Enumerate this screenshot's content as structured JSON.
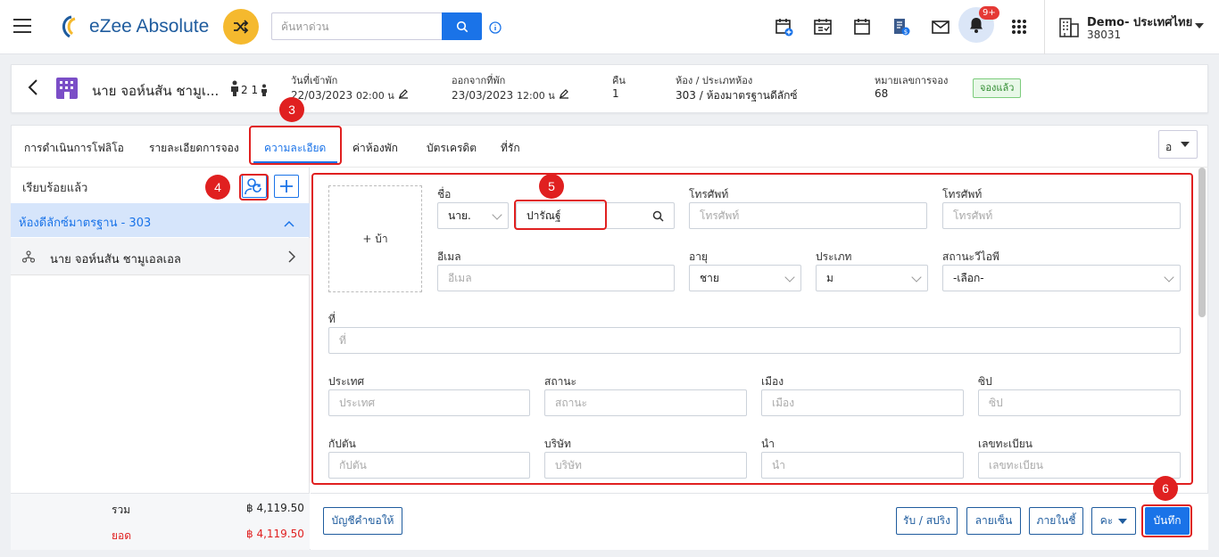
{
  "header": {
    "logo_text": "eZee Absolute",
    "search_placeholder": "ค้นหาด่วน",
    "notification_badge": "9+",
    "hotel_name": "Demo- ประเทศไทย",
    "hotel_id": "38031"
  },
  "booking": {
    "guest_name": "นาย จอห์นสัน ชามูเ...",
    "pax": "2 1",
    "checkin_label": "วันที่เข้าพัก",
    "checkin_date": "22/03/2023",
    "checkin_time": "02:00 น",
    "checkout_label": "ออกจากที่พัก",
    "checkout_date": "23/03/2023",
    "checkout_time": "12:00 น",
    "nights_label": "คืน",
    "nights": "1",
    "room_label": "ห้อง / ประเภทห้อง",
    "room_value": "303 / ห้องมาตรฐานดีลักซ์",
    "resno_label": "หมายเลขการจอง",
    "resno": "68",
    "status": "จองแล้ว"
  },
  "tabs": [
    {
      "label": "การดำเนินการโฟลิโอ"
    },
    {
      "label": "รายละเอียดการจอง"
    },
    {
      "label": "ความละเอียด"
    },
    {
      "label": "ค่าห้องพัก"
    },
    {
      "label": "บัตรเครดิต"
    },
    {
      "label": "ที่รัก"
    }
  ],
  "small_select": "อ",
  "left_panel": {
    "heading": "เรียบร้อยแล้ว",
    "room_group": "ห้องดีลักซ์มาตรฐาน - 303",
    "guest": "นาย จอห์นสัน ชามูเอลเอล",
    "total_label": "รวม",
    "total_value": "฿ 4,119.50",
    "balance_label": "ยอด",
    "balance_value": "฿ 4,119.50"
  },
  "form": {
    "photo_label": "+ บ้า",
    "name_label": "ชื่อ",
    "title_value": "นาย.",
    "name_value": "ปารัณฐ์",
    "phone1_label": "โทรศัพท์",
    "phone1_placeholder": "โทรศัพท์",
    "phone2_label": "โทรศัพท์",
    "phone2_placeholder": "โทรศัพท์",
    "email_label": "อีเมล",
    "email_placeholder": "อีเมล",
    "age_label": "อายุ",
    "age_value": "ชาย",
    "type_label": "ประเภท",
    "type_value": "ม",
    "wifi_label": "สถานะวีไอพี",
    "wifi_value": "-เลือก-",
    "address_label": "ที่",
    "address_placeholder": "ที่",
    "country_label": "ประเทศ",
    "country_placeholder": "ประเทศ",
    "state_label": "สถานะ",
    "state_placeholder": "สถานะ",
    "city_label": "เมือง",
    "city_placeholder": "เมือง",
    "zip_label": "ซิป",
    "zip_placeholder": "ซิป",
    "captain_label": "กัปตัน",
    "captain_placeholder": "กัปตัน",
    "company_label": "บริษัท",
    "company_placeholder": "บริษัท",
    "bring_label": "นำ",
    "bring_placeholder": "นำ",
    "reg_label": "เลขทะเบียน",
    "reg_placeholder": "เลขทะเบียน"
  },
  "buttons": {
    "request_account": "บัญชีคำขอให้",
    "checkin_swap": "รับ / สปริง",
    "signature": "ลายเซ็น",
    "later": "ภายในชี้",
    "more": "คะ",
    "save": "บันทึก"
  },
  "steps": [
    "3",
    "4",
    "5",
    "6"
  ],
  "colors": {
    "accent": "#1a73e8",
    "highlight": "#e02020",
    "badge_green": "#2e8b2e"
  }
}
